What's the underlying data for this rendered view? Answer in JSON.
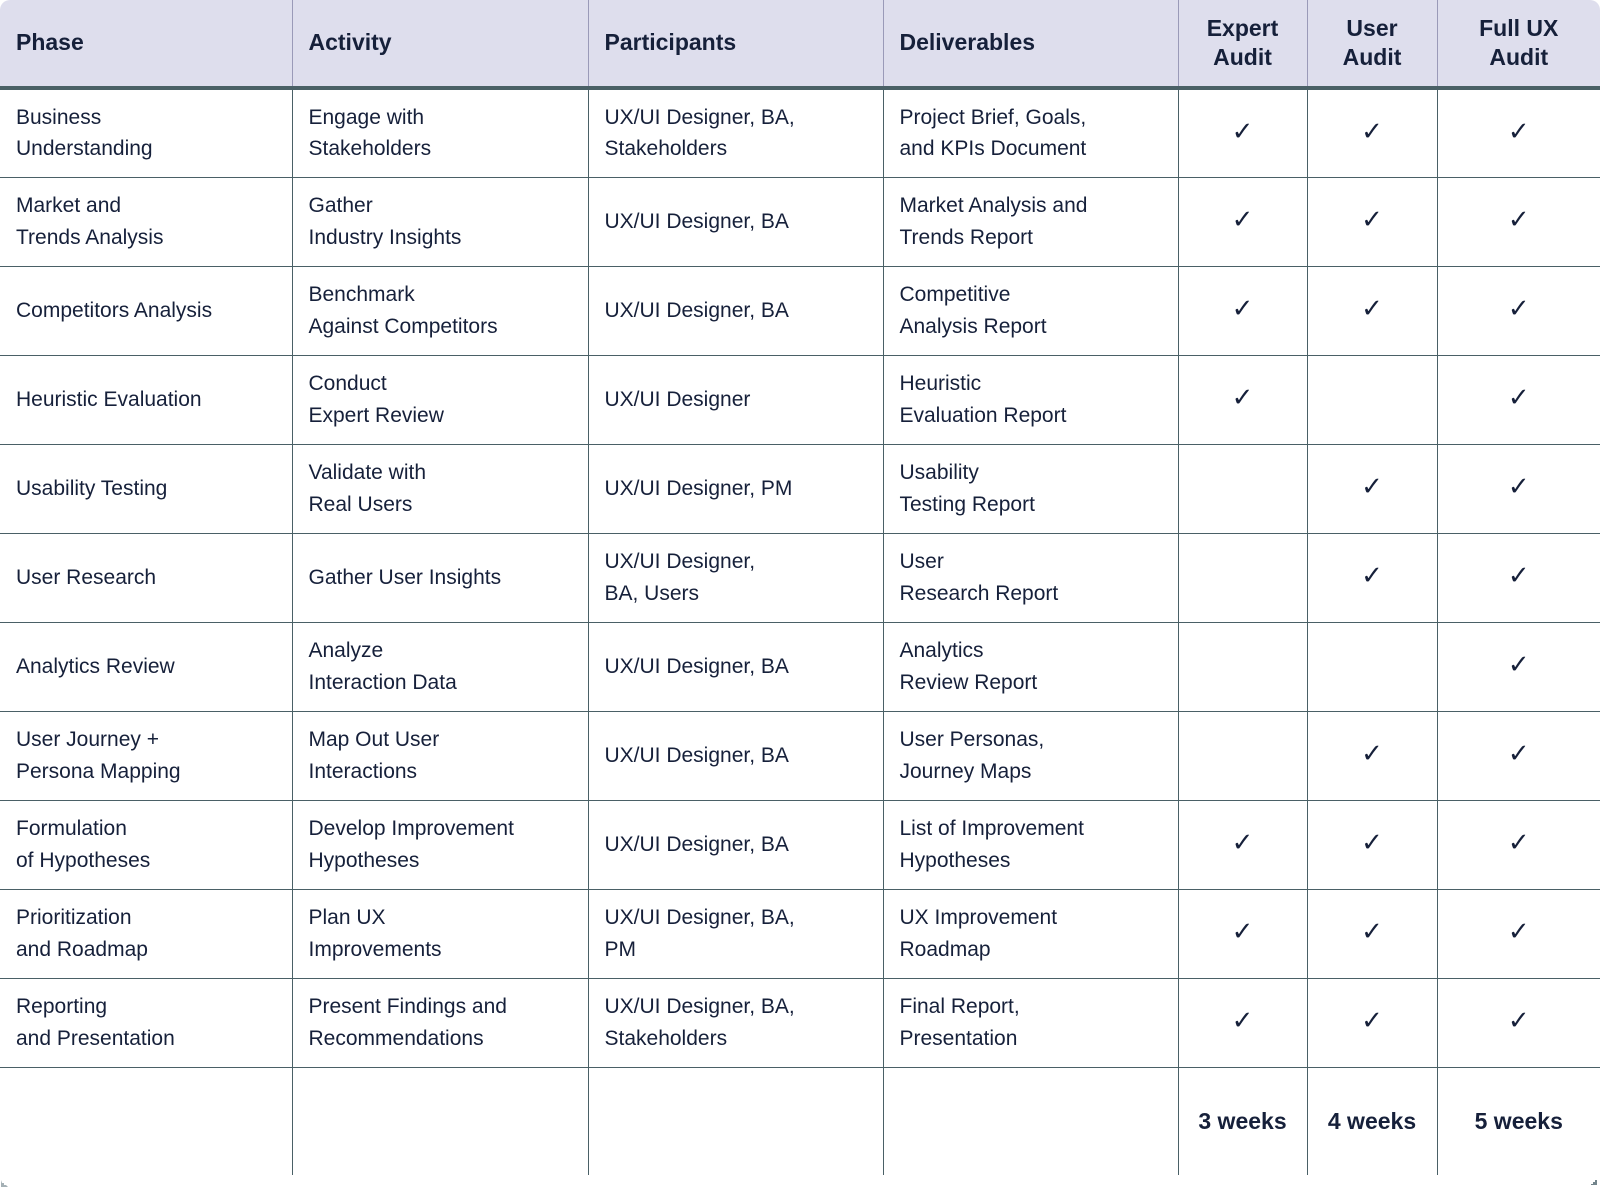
{
  "table": {
    "columns": [
      {
        "key": "phase",
        "label": "Phase"
      },
      {
        "key": "activity",
        "label": "Activity"
      },
      {
        "key": "participants",
        "label": "Participants"
      },
      {
        "key": "deliverables",
        "label": "Deliverables"
      }
    ],
    "audit_columns": [
      {
        "key": "expert",
        "label_line1": "Expert",
        "label_line2": "Audit"
      },
      {
        "key": "user",
        "label_line1": "User",
        "label_line2": "Audit"
      },
      {
        "key": "full",
        "label_line1": "Full UX",
        "label_line2": "Audit"
      }
    ],
    "check_glyph": "✓",
    "rows": [
      {
        "phase_l1": "Business",
        "phase_l2": "Understanding",
        "activity_l1": "Engage with",
        "activity_l2": "Stakeholders",
        "participants_l1": "UX/UI Designer, BA,",
        "participants_l2": "Stakeholders",
        "deliverables_l1": "Project Brief, Goals,",
        "deliverables_l2": "and KPIs Document",
        "expert": true,
        "user": true,
        "full": true
      },
      {
        "phase_l1": "Market and",
        "phase_l2": "Trends Analysis",
        "activity_l1": "Gather",
        "activity_l2": "Industry Insights",
        "participants_l1": "UX/UI Designer, BA",
        "participants_l2": "",
        "deliverables_l1": "Market Analysis and",
        "deliverables_l2": "Trends Report",
        "expert": true,
        "user": true,
        "full": true
      },
      {
        "phase_l1": "Competitors Analysis",
        "phase_l2": "",
        "activity_l1": "Benchmark",
        "activity_l2": "Against Competitors",
        "participants_l1": "UX/UI Designer, BA",
        "participants_l2": "",
        "deliverables_l1": "Competitive",
        "deliverables_l2": "Analysis Report",
        "expert": true,
        "user": true,
        "full": true
      },
      {
        "phase_l1": "Heuristic Evaluation",
        "phase_l2": "",
        "activity_l1": "Conduct",
        "activity_l2": "Expert Review",
        "participants_l1": "UX/UI Designer",
        "participants_l2": "",
        "deliverables_l1": "Heuristic",
        "deliverables_l2": "Evaluation Report",
        "expert": true,
        "user": false,
        "full": true
      },
      {
        "phase_l1": "Usability Testing",
        "phase_l2": "",
        "activity_l1": "Validate with",
        "activity_l2": "Real Users",
        "participants_l1": "UX/UI Designer, PM",
        "participants_l2": "",
        "deliverables_l1": "Usability",
        "deliverables_l2": "Testing Report",
        "expert": false,
        "user": true,
        "full": true
      },
      {
        "phase_l1": "User Research",
        "phase_l2": "",
        "activity_l1": "Gather User Insights",
        "activity_l2": "",
        "participants_l1": "UX/UI Designer,",
        "participants_l2": "BA, Users",
        "deliverables_l1": "User",
        "deliverables_l2": "Research Report",
        "expert": false,
        "user": true,
        "full": true
      },
      {
        "phase_l1": "Analytics Review",
        "phase_l2": "",
        "activity_l1": "Analyze",
        "activity_l2": "Interaction Data",
        "participants_l1": "UX/UI Designer, BA",
        "participants_l2": "",
        "deliverables_l1": "Analytics",
        "deliverables_l2": "Review Report",
        "expert": false,
        "user": false,
        "full": true
      },
      {
        "phase_l1": "User Journey +",
        "phase_l2": "Persona Mapping",
        "activity_l1": "Map Out User",
        "activity_l2": "Interactions",
        "participants_l1": "UX/UI Designer, BA",
        "participants_l2": "",
        "deliverables_l1": "User Personas,",
        "deliverables_l2": "Journey Maps",
        "expert": false,
        "user": true,
        "full": true
      },
      {
        "phase_l1": "Formulation",
        "phase_l2": "of Hypotheses",
        "activity_l1": "Develop Improvement",
        "activity_l2": "Hypotheses",
        "participants_l1": "UX/UI Designer, BA",
        "participants_l2": "",
        "deliverables_l1": "List of Improvement",
        "deliverables_l2": "Hypotheses",
        "expert": true,
        "user": true,
        "full": true
      },
      {
        "phase_l1": "Prioritization",
        "phase_l2": "and Roadmap",
        "activity_l1": "Plan UX",
        "activity_l2": "Improvements",
        "participants_l1": "UX/UI Designer, BA,",
        "participants_l2": "PM",
        "deliverables_l1": "UX Improvement",
        "deliverables_l2": "Roadmap",
        "expert": true,
        "user": true,
        "full": true
      },
      {
        "phase_l1": "Reporting",
        "phase_l2": "and Presentation",
        "activity_l1": "Present Findings and",
        "activity_l2": "Recommendations",
        "participants_l1": "UX/UI Designer, BA,",
        "participants_l2": "Stakeholders",
        "deliverables_l1": "Final Report,",
        "deliverables_l2": "Presentation",
        "expert": true,
        "user": true,
        "full": true
      }
    ],
    "footer": {
      "expert_duration": "3 weeks",
      "user_duration": "4 weeks",
      "full_duration": "5 weeks"
    }
  },
  "colors": {
    "header_background": "#dedeed",
    "border": "#4a6066",
    "header_divider": "#9a9ab8",
    "text": "#16203a",
    "page_background": "#ffffff"
  }
}
